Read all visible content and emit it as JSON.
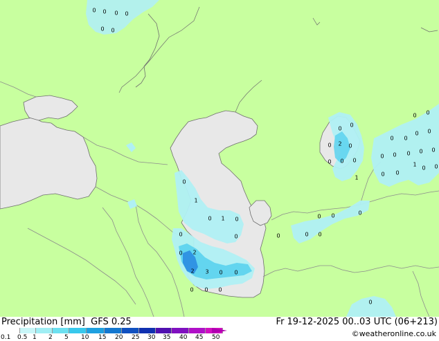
{
  "title": "Precipitation [mm]",
  "model": "GFS 0.25",
  "valid_time": "Fr 19-12-2025 00..03 UTC (06+213)",
  "credit": "©weatheronline.co.uk",
  "colors": {
    "land": "#c8ff9f",
    "water": "#e8e8e8",
    "border": "#8c8c8c",
    "coast": "#6e6e6e",
    "light_precip": "#b0f0f4",
    "mid_precip": "#5ad2ee",
    "heavy_precip": "#2888e0"
  },
  "legend": {
    "ticks": [
      "0.1",
      "0.5",
      "1",
      "2",
      "5",
      "10",
      "15",
      "20",
      "25",
      "30",
      "35",
      "40",
      "45",
      "50"
    ],
    "colors": [
      "#ffffff",
      "#c8f6f8",
      "#a0eef4",
      "#6ce0f0",
      "#38c8ec",
      "#1ea0e0",
      "#1478d0",
      "#1050c0",
      "#1030b0",
      "#5010b0",
      "#8010c0",
      "#b010c8",
      "#d010c0",
      "#e010d0"
    ]
  },
  "map_labels": {
    "north_top": [
      "0",
      "0",
      "0",
      "0"
    ],
    "north_lower": [
      "0",
      "0"
    ],
    "aral_region": [
      "0",
      "0",
      "0",
      "2",
      "0",
      "0",
      "0",
      "0",
      "1"
    ],
    "east": [
      "0",
      "0",
      "0",
      "0",
      "0",
      "0",
      "0",
      "0",
      "0",
      "0",
      "0",
      "1",
      "0",
      "0",
      "0",
      "0",
      "0"
    ],
    "caspian_west": [
      "0",
      "1",
      "0",
      "1",
      "0",
      "0"
    ],
    "caspian_south": [
      "0",
      "2",
      "0",
      "2",
      "3",
      "0",
      "0",
      "0",
      "0"
    ],
    "turkmen": [
      "0",
      "0",
      "0",
      "0",
      "0"
    ],
    "bottom_right": [
      "0"
    ]
  }
}
